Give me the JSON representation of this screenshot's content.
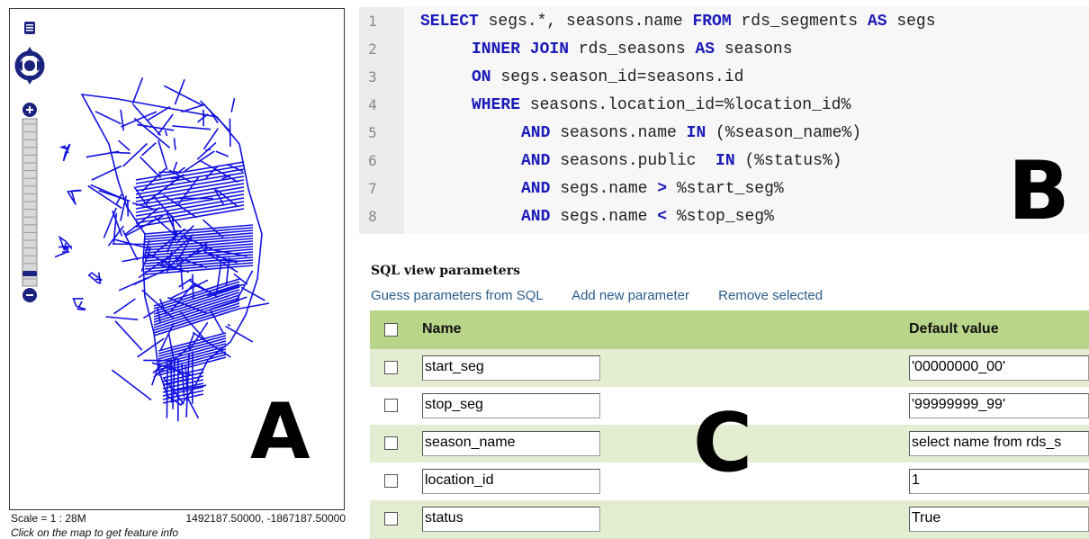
{
  "map": {
    "scale_text": "Scale = 1 : 28M",
    "coordinates_text": "1492187.50000, -1867187.50000",
    "hint_text": "Click on the map to get feature info",
    "line_color": "#1010e0",
    "control_color": "#1a237e"
  },
  "sql": {
    "lines": [
      {
        "num": "1",
        "parts": [
          [
            "kw",
            "SELECT"
          ],
          [
            "t",
            " segs.*, seasons.name "
          ],
          [
            "kw",
            "FROM"
          ],
          [
            "t",
            " rds_segments "
          ],
          [
            "kw",
            "AS"
          ],
          [
            "t",
            " segs"
          ]
        ]
      },
      {
        "num": "2",
        "parts": [
          [
            "kw",
            "INNER JOIN"
          ],
          [
            "t",
            " rds_seasons "
          ],
          [
            "kw",
            "AS"
          ],
          [
            "t",
            " seasons"
          ]
        ]
      },
      {
        "num": "3",
        "parts": [
          [
            "kw",
            "ON"
          ],
          [
            "t",
            " segs.season_id=seasons.id"
          ]
        ]
      },
      {
        "num": "4",
        "parts": [
          [
            "kw",
            "WHERE"
          ],
          [
            "t",
            " seasons.location_id=%location_id%"
          ]
        ]
      },
      {
        "num": "5",
        "parts": [
          [
            "kw",
            "AND"
          ],
          [
            "t",
            " seasons.name "
          ],
          [
            "kw",
            "IN"
          ],
          [
            "t",
            " (%season_name%)"
          ]
        ]
      },
      {
        "num": "6",
        "parts": [
          [
            "kw",
            "AND"
          ],
          [
            "t",
            " seasons.public  "
          ],
          [
            "kw",
            "IN"
          ],
          [
            "t",
            " (%status%)"
          ]
        ]
      },
      {
        "num": "7",
        "parts": [
          [
            "kw",
            "AND"
          ],
          [
            "t",
            " segs.name "
          ],
          [
            "kw",
            ">"
          ],
          [
            "t",
            " %start_seg%"
          ]
        ]
      },
      {
        "num": "8",
        "parts": [
          [
            "kw",
            "AND"
          ],
          [
            "t",
            " segs.name "
          ],
          [
            "kw",
            "<"
          ],
          [
            "t",
            " %stop_seg%"
          ]
        ]
      }
    ]
  },
  "params": {
    "title": "SQL view parameters",
    "links": [
      "Guess parameters from SQL",
      "Add new parameter",
      "Remove selected"
    ],
    "columns": {
      "name": "Name",
      "default": "Default value"
    },
    "rows": [
      {
        "name": "start_seg",
        "default": "'00000000_00'"
      },
      {
        "name": "stop_seg",
        "default": "'99999999_99'"
      },
      {
        "name": "season_name",
        "default": "select name from rds_s"
      },
      {
        "name": "location_id",
        "default": "1"
      },
      {
        "name": "status",
        "default": "True"
      }
    ]
  },
  "labels": {
    "a": "A",
    "b": "B",
    "c": "C"
  }
}
